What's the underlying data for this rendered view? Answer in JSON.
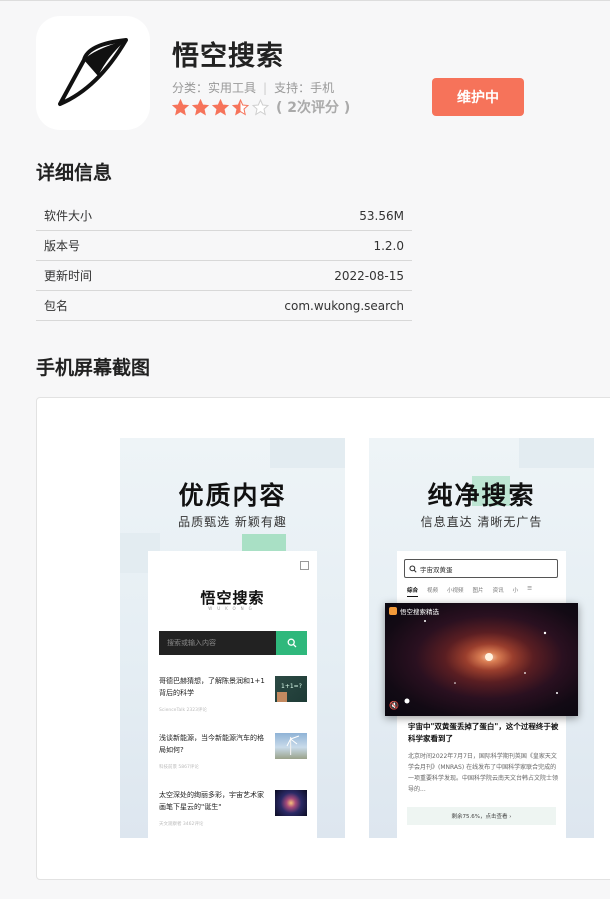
{
  "app": {
    "name": "悟空搜索",
    "category_label": "分类：",
    "category": "实用工具",
    "support_label": "支持：",
    "support": "手机",
    "rating_stars": 3.5,
    "rating_count": "( 2次评分 )",
    "status_button": "维护中"
  },
  "details": {
    "title": "详细信息",
    "rows": [
      {
        "label": "软件大小",
        "value": "53.56M"
      },
      {
        "label": "版本号",
        "value": "1.2.0"
      },
      {
        "label": "更新时间",
        "value": "2022-08-15"
      },
      {
        "label": "包名",
        "value": "com.wukong.search"
      }
    ]
  },
  "screenshots": {
    "title": "手机屏幕截图",
    "shot1": {
      "headline": "优质内容",
      "subline": "品质甄选 新颖有趣",
      "logo": "悟空搜索",
      "logo_sub": "WUKONG",
      "search_placeholder": "搜索或输入内容",
      "news": [
        {
          "title": "哥德巴赫猜想，了解陈景润和1+1背后的科学",
          "meta": "ScienceTalk  2323评论"
        },
        {
          "title": "浅谈新能源，当今新能源汽车的格局如何?",
          "meta": "科技前景  5867评论"
        },
        {
          "title": "太空深处的绚丽多彩，宇宙艺术家画笔下星云的\"诞生\"",
          "meta": "天文观察者  3462评论"
        }
      ]
    },
    "shot2": {
      "headline": "纯净搜索",
      "subline": "信息直达 清晰无广告",
      "search_query": "宇宙双黄蛋",
      "tabs": [
        "综合",
        "视频",
        "小视频",
        "图片",
        "资讯",
        "小"
      ],
      "video_label": "悟空搜索精选",
      "article_title": "宇宙中\"双黄蛋丢掉了蛋白\"，这个过程终于被科学家看到了",
      "article_body": "北京时间2022年7月7日，国际科学期刊英国《皇家天文学会月刊》(MNRAS) 在线发布了中国科学家联合完成的一项重要科学发现。中国科学院云南天文台韩占文院士领导的...",
      "more": "剩余75.6%，点击查看 ›"
    }
  },
  "colors": {
    "accent": "#f6735a",
    "star": "#f6735a",
    "green": "#2fb87c"
  }
}
